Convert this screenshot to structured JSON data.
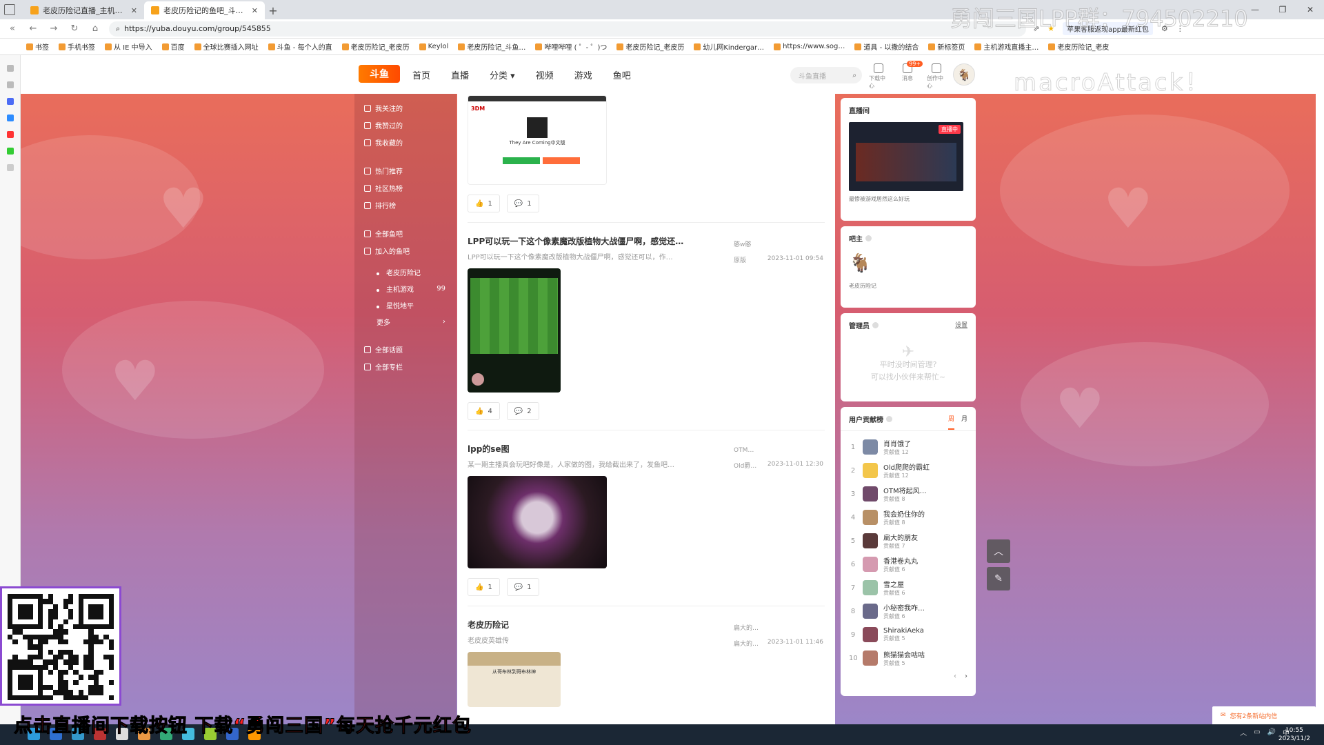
{
  "browser": {
    "tabs": [
      {
        "title": "老皮历险记直播_主机其他游戏直播",
        "active": false
      },
      {
        "title": "老皮历险记的鱼吧_斗鱼鱼吧",
        "active": true
      }
    ],
    "url": "https://yuba.douyu.com/group/545855",
    "extension_ad": "苹果客服返现app最新红包",
    "bookmarks": [
      "书签",
      "手机书签",
      "从 IE 中导入",
      "百度",
      "全球比赛插入网址",
      "斗鱼 - 每个人的直",
      "老皮历险记_老皮历",
      "Keylol",
      "老皮历险记_斗鱼…",
      "哔哩哔哩 ( ゜- ゜)つ",
      "老皮历险记_老皮历",
      "幼儿网Kindergar…",
      "https://www.sog…",
      "道具 - 以撒的结合",
      "新标签页",
      "主机游戏直播主…",
      "老皮历险记_老皮"
    ]
  },
  "header": {
    "logo": "斗鱼",
    "nav": [
      "首页",
      "直播",
      "分类",
      "视频",
      "游戏",
      "鱼吧"
    ],
    "search_placeholder": "斗鱼直播",
    "icons": [
      {
        "label": "下载中心",
        "icon": "download-icon"
      },
      {
        "label": "消息",
        "icon": "message-icon",
        "badge": "99+"
      },
      {
        "label": "创作中心",
        "icon": "create-icon"
      }
    ]
  },
  "leftnav": {
    "group1": [
      "我关注的",
      "我赞过的",
      "我收藏的"
    ],
    "group2": [
      "热门推荐",
      "社区热榜",
      "排行榜"
    ],
    "group3": [
      "全部鱼吧",
      "加入的鱼吧"
    ],
    "joined": [
      {
        "name": "老皮历险记",
        "count": ""
      },
      {
        "name": "主机游戏",
        "count": "99"
      },
      {
        "name": "星悦地平",
        "count": ""
      }
    ],
    "more": "更多",
    "group4": [
      "全部话题",
      "全部专栏"
    ]
  },
  "feed": {
    "posts": [
      {
        "title": "",
        "desc": "",
        "author": "",
        "tag": "",
        "time": "",
        "image_caption": "They Are Coming中文版",
        "likes": "1",
        "comments": "1"
      },
      {
        "title": "LPP可以玩一下这个像素魔改版植物大战僵尸啊，感觉还…",
        "desc": "LPP可以玩一下这个像素魔改版植物大战僵尸啊，感觉还可以，作…",
        "author": "憨w憨",
        "tag": "原版",
        "time": "2023-11-01 09:54",
        "likes": "4",
        "comments": "2"
      },
      {
        "title": "lpp的se图",
        "desc": "某一期主播真会玩吧好像是，人家做的图，我给截出来了，发鱼吧…",
        "author": "OTM…",
        "tag": "Old爵…",
        "time": "2023-11-01 12:30",
        "likes": "1",
        "comments": "1"
      },
      {
        "title": "老皮历险记",
        "desc": "老皮皮英雄传",
        "author": "扁大的…",
        "tag": "扁大的…",
        "time": "2023-11-01 11:46",
        "image_caption": "从哥布林到哥布林神",
        "likes": "",
        "comments": ""
      }
    ]
  },
  "right": {
    "live_card": {
      "title": "直播间",
      "badge": "直播中",
      "caption": "最惨被游戏居然这么好玩"
    },
    "owner_card": {
      "title": "吧主",
      "owner_name": "老皮历险记"
    },
    "admin_card": {
      "title": "管理员",
      "action": "设置",
      "empty_line1": "平时没时间管理?",
      "empty_line2": "可以找小伙伴来帮忙~"
    },
    "rank_card": {
      "title": "用户贡献榜",
      "tabs": [
        "周",
        "月"
      ],
      "score_label": "贡献值",
      "rows": [
        {
          "rank": "1",
          "name": "肖肖饿了",
          "score": "12"
        },
        {
          "rank": "2",
          "name": "Old爬爬的霸虹",
          "score": "12"
        },
        {
          "rank": "3",
          "name": "OTM将起风…",
          "score": "8"
        },
        {
          "rank": "4",
          "name": "我会奶住你的",
          "score": "8"
        },
        {
          "rank": "5",
          "name": "扁大的朋友",
          "score": "7"
        },
        {
          "rank": "6",
          "name": "香港卷丸丸",
          "score": "6"
        },
        {
          "rank": "7",
          "name": "雪之屋",
          "score": "6"
        },
        {
          "rank": "8",
          "name": "小秘密我咋…",
          "score": "6"
        },
        {
          "rank": "9",
          "name": "ShirakiAeka",
          "score": "5"
        },
        {
          "rank": "10",
          "name": "熊猫猫会咕咕",
          "score": "5"
        }
      ]
    }
  },
  "toast": "您有2条新站内信",
  "overlay": {
    "banner": "点击直播间下载按钮 下载“勇闯三国”每天抢千元红包",
    "watermark_top": "勇闯三国LPP群：794502210",
    "watermark_mid": "macroAttack！"
  },
  "taskbar": {
    "ime": "中",
    "time": "10:55",
    "date": "2023/11/2"
  }
}
